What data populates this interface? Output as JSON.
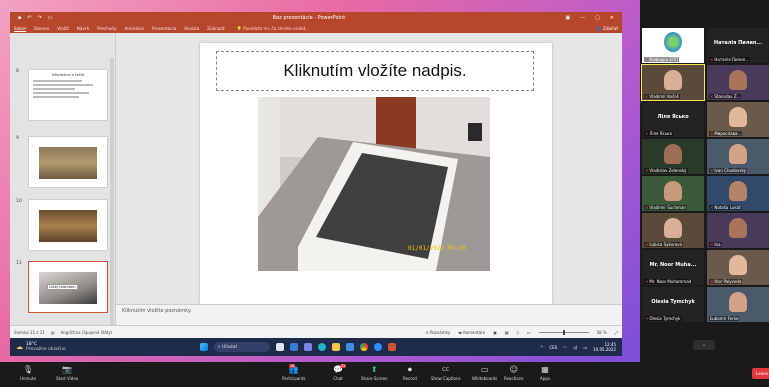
{
  "ppt": {
    "title": "Bez prezentácie - PowerPoint",
    "ribbon_tabs": [
      "Súbor",
      "Domov",
      "Vložiť",
      "Návrh",
      "Prechody",
      "Animácie",
      "Prezentácia",
      "Revízia",
      "Zobraziť"
    ],
    "ribbon_search": "Povedzte mi, čo chcete urobiť...",
    "share_label": "Zdieľať",
    "thumbnails": [
      {
        "num": "8",
        "kind": "text",
        "title": "Informácie o tečte"
      },
      {
        "num": "9",
        "kind": "photo"
      },
      {
        "num": "10",
        "kind": "photo"
      },
      {
        "num": "11",
        "kind": "photo",
        "caption": "Ľahký talentkem"
      }
    ],
    "slide_title": "Kliknutím vložíte nadpis.",
    "photo_stamp": "01/01/2022 00:20",
    "notes_placeholder": "Kliknutím vložíte poznámky.",
    "status_left": "Snímka 11 z 11",
    "status_lang": "Angličtina (Spojené štáty)",
    "status_notes": "Poznámky",
    "status_comments": "Komentáre",
    "zoom_level": "58 %"
  },
  "taskbar": {
    "weather_temp": "18°C",
    "weather_desc": "Prevažne oblačno",
    "search_label": "Hľadať",
    "lang": "CES",
    "time": "12:45",
    "date": "10.05.2022"
  },
  "gallery": {
    "tiles": [
      {
        "name": "Кафедра ЕПП",
        "mute": true,
        "kind": "logo"
      },
      {
        "name": "Наталія Пилип...",
        "mute": true,
        "kind": "bigname"
      },
      {
        "name": "Vladimír Kočeš",
        "mute": true,
        "kind": "face",
        "speaking": true
      },
      {
        "name": "Stanislav Z...",
        "mute": true,
        "kind": "face"
      },
      {
        "name": "Ліля Ясько",
        "mute": true,
        "kind": "bigname"
      },
      {
        "name": "Мирослава...",
        "mute": true,
        "kind": "face"
      },
      {
        "name": "Vladislav Zelenský",
        "mute": true,
        "kind": "face"
      },
      {
        "name": "Ivan Chudovský",
        "mute": true,
        "kind": "face"
      },
      {
        "name": "Vladimír Šuchman",
        "mute": true,
        "kind": "face"
      },
      {
        "name": "Nataša Lukáč",
        "mute": true,
        "kind": "face"
      },
      {
        "name": "Ľubica Sykorová",
        "mute": true,
        "kind": "face"
      },
      {
        "name": "Ina",
        "mute": true,
        "kind": "face"
      },
      {
        "name": "Mr. Noor Muha...",
        "mute": true,
        "kind": "bigname",
        "sub": "Mr. Noor Muhammad"
      },
      {
        "name": "Ihor Palyvoda",
        "mute": true,
        "kind": "face"
      },
      {
        "name": "Olesia Tymchyk",
        "mute": true,
        "kind": "bigname",
        "sub": "Olesia Tymchyk"
      },
      {
        "name": "Ľubomír Ferko",
        "mute": false,
        "kind": "face"
      }
    ],
    "collapse_label": "⌄"
  },
  "zoombar": {
    "left": [
      {
        "label": "Unmute",
        "icon": "🎙"
      },
      {
        "label": "Start Video",
        "icon": "📷"
      }
    ],
    "center": [
      {
        "label": "Participants",
        "icon": "👥",
        "badge": "18"
      },
      {
        "label": "Chat",
        "icon": "💬",
        "badge": "22"
      },
      {
        "label": "Share Screen",
        "icon": "⬆",
        "green": true
      },
      {
        "label": "Record",
        "icon": "⏺"
      },
      {
        "label": "Show Captions",
        "icon": "CC"
      },
      {
        "label": "Reactions",
        "icon": "☺"
      },
      {
        "label": "Apps",
        "icon": "▦"
      }
    ],
    "extra": {
      "label": "Whiteboards",
      "icon": "▭"
    },
    "leave_label": "Leave"
  },
  "colors": {
    "ppt_accent": "#b7472a",
    "zoom_green": "#3ccf63",
    "zoom_red": "#e0383e",
    "speaker_outline": "#f6e94a"
  }
}
